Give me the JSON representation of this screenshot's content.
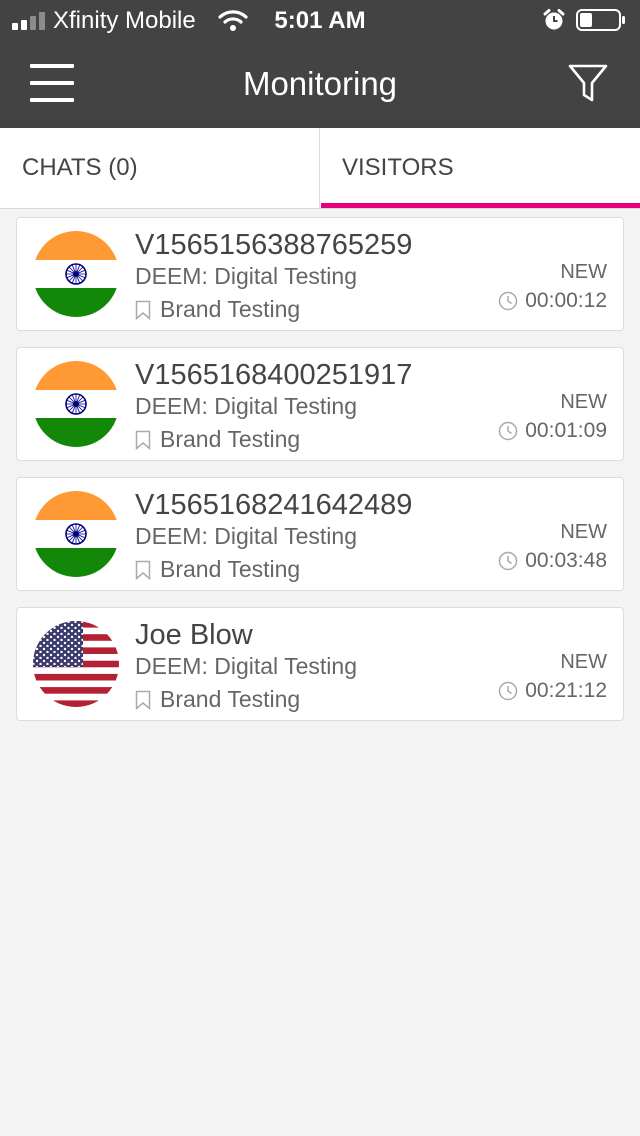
{
  "status_bar": {
    "carrier": "Xfinity Mobile",
    "time": "5:01 AM",
    "icons": [
      "signal-icon",
      "wifi-icon",
      "alarm-icon",
      "battery-icon"
    ]
  },
  "header": {
    "title": "Monitoring",
    "icons": [
      "menu-icon",
      "filter-icon"
    ]
  },
  "tabs": [
    {
      "label": "CHATS (0)",
      "active": false
    },
    {
      "label": "VISITORS",
      "active": true
    }
  ],
  "accent_color": "#e6007e",
  "header_color": "#434343",
  "visitors": [
    {
      "name": "V1565156388765259",
      "department": "DEEM: Digital Testing",
      "group": "Brand Testing",
      "status": "NEW",
      "duration": "00:00:12",
      "flag": "india-flag-icon"
    },
    {
      "name": "V1565168400251917",
      "department": "DEEM: Digital Testing",
      "group": "Brand Testing",
      "status": "NEW",
      "duration": "00:01:09",
      "flag": "india-flag-icon"
    },
    {
      "name": "V1565168241642489",
      "department": "DEEM: Digital Testing",
      "group": "Brand Testing",
      "status": "NEW",
      "duration": "00:03:48",
      "flag": "india-flag-icon"
    },
    {
      "name": "Joe Blow",
      "department": "DEEM: Digital Testing",
      "group": "Brand Testing",
      "status": "NEW",
      "duration": "00:21:12",
      "flag": "usa-flag-icon"
    }
  ]
}
